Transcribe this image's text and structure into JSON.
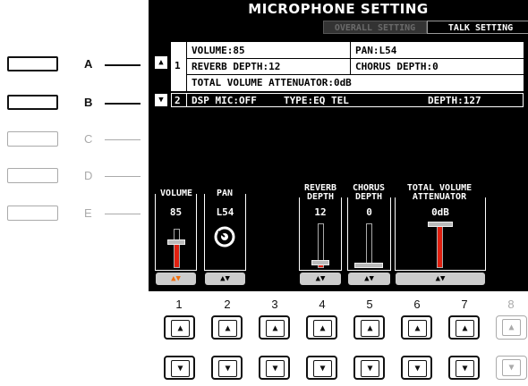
{
  "screen": {
    "title": "MICROPHONE SETTING",
    "tabs": [
      {
        "label": "OVERALL SETTING",
        "active": false
      },
      {
        "label": "TALK SETTING",
        "active": true
      }
    ]
  },
  "side_buttons": [
    {
      "label": "A",
      "enabled": true
    },
    {
      "label": "B",
      "enabled": true
    },
    {
      "label": "C",
      "enabled": false
    },
    {
      "label": "D",
      "enabled": false
    },
    {
      "label": "E",
      "enabled": false
    }
  ],
  "settings_list": {
    "up_arrow": "▲",
    "down_arrow": "▼",
    "set1": {
      "number": "1",
      "volume": "VOLUME:85",
      "pan": "PAN:L54",
      "reverb_depth": "REVERB DEPTH:12",
      "chorus_depth": "CHORUS DEPTH:0",
      "total_volume_attenuator": "TOTAL VOLUME ATTENUATOR:0dB"
    },
    "set2": {
      "number": "2",
      "dsp_mic": "DSP MIC:OFF",
      "type": "TYPE:EQ TEL",
      "depth": "DEPTH:127"
    }
  },
  "controls": {
    "volume": {
      "label": "VOLUME",
      "value": "85",
      "level": 85,
      "max": 127
    },
    "pan": {
      "label": "PAN",
      "value": "L54"
    },
    "reverb_depth": {
      "label1": "REVERB",
      "label2": "DEPTH",
      "value": "12",
      "level": 12,
      "max": 127
    },
    "chorus_depth": {
      "label1": "CHORUS",
      "label2": "DEPTH",
      "value": "0",
      "level": 0,
      "max": 127
    },
    "total_volume_attenuator": {
      "label1": "TOTAL VOLUME",
      "label2": "ATTENUATOR",
      "value": "0dB",
      "level": 1.0
    },
    "updown_glyph": "▲▼"
  },
  "bottom_numbers": [
    "1",
    "2",
    "3",
    "4",
    "5",
    "6",
    "7",
    "8"
  ],
  "bottom_buttons": {
    "up": "▲",
    "down": "▼"
  },
  "colors": {
    "accent": "#e02010",
    "active_arrow": "#f07010"
  }
}
